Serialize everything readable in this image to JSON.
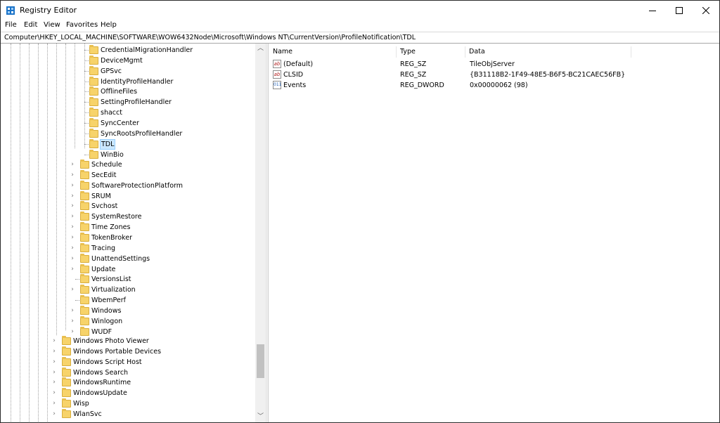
{
  "window": {
    "title": "Registry Editor",
    "icon": "regedit-icon",
    "controls": {
      "minimize": "minimize-icon",
      "maximize": "maximize-icon",
      "close": "close-icon"
    }
  },
  "menu": {
    "file": "File",
    "edit": "Edit",
    "view": "View",
    "favorites": "Favorites",
    "help": "Help"
  },
  "address": "Computer\\HKEY_LOCAL_MACHINE\\SOFTWARE\\WOW6432Node\\Microsoft\\Windows NT\\CurrentVersion\\ProfileNotification\\TDL",
  "tree": {
    "profile_notification_children": [
      "CredentialMigrationHandler",
      "DeviceMgmt",
      "GPSvc",
      "IdentityProfileHandler",
      "OfflineFiles",
      "SettingProfileHandler",
      "shacct",
      "SyncCenter",
      "SyncRootsProfileHandler",
      "TDL",
      "WinBio"
    ],
    "selected": "TDL",
    "current_version_children": [
      "Schedule",
      "SecEdit",
      "SoftwareProtectionPlatform",
      "SRUM",
      "Svchost",
      "SystemRestore",
      "Time Zones",
      "TokenBroker",
      "Tracing",
      "UnattendSettings",
      "Update",
      "VersionsList",
      "Virtualization",
      "WbemPerf",
      "Windows",
      "Winlogon",
      "WUDF"
    ],
    "microsoft_children": [
      "Windows Photo Viewer",
      "Windows Portable Devices",
      "Windows Script Host",
      "Windows Search",
      "WindowsRuntime",
      "WindowsUpdate",
      "Wisp",
      "WlanSvc"
    ]
  },
  "list": {
    "headers": {
      "name": "Name",
      "type": "Type",
      "data": "Data"
    },
    "rows": [
      {
        "icon": "ab",
        "name": "(Default)",
        "type": "REG_SZ",
        "data": "TileObjServer"
      },
      {
        "icon": "ab",
        "name": "CLSID",
        "type": "REG_SZ",
        "data": "{B31118B2-1F49-48E5-B6F5-BC21CAEC56FB}"
      },
      {
        "icon": "011",
        "name": "Events",
        "type": "REG_DWORD",
        "data": "0x00000062 (98)"
      }
    ]
  },
  "colors": {
    "folder": "#f7d36a",
    "selection": "#cce8ff",
    "selection_border": "#99d1ff"
  }
}
